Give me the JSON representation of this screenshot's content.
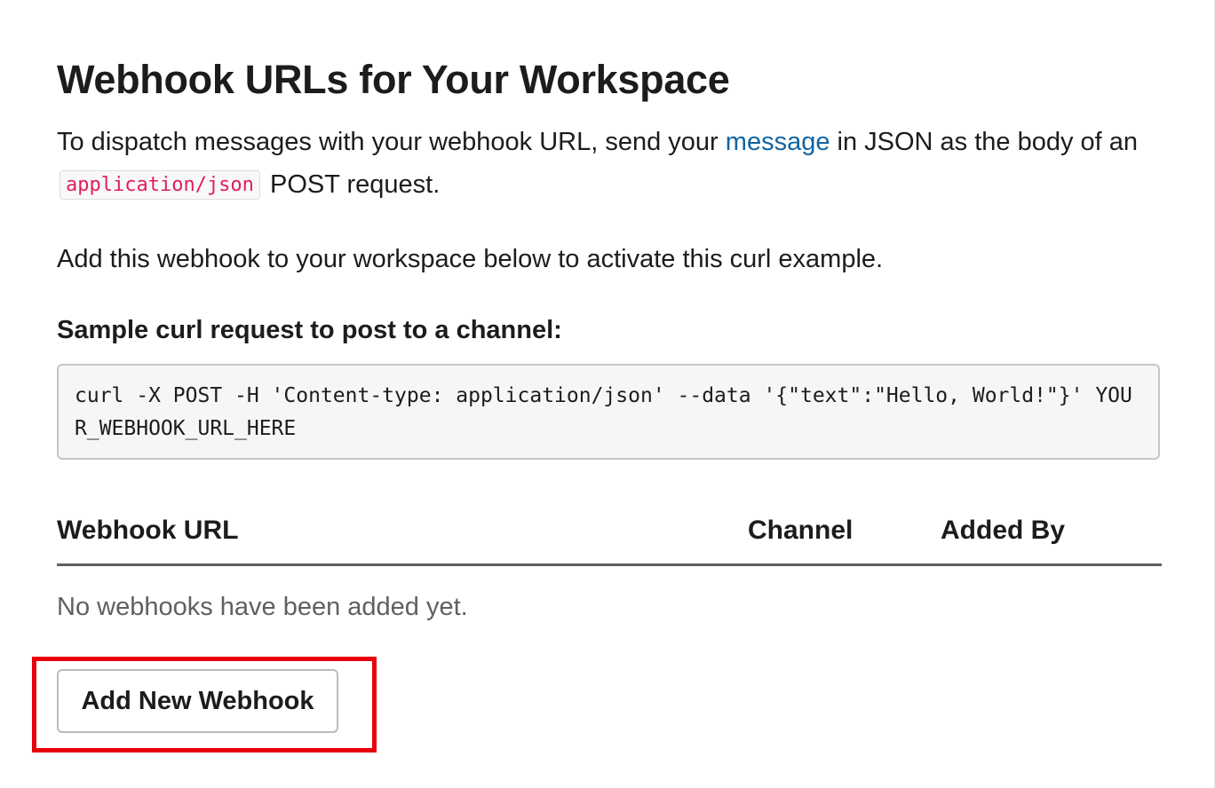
{
  "page": {
    "title": "Webhook URLs for Your Workspace"
  },
  "intro": {
    "before_link": "To dispatch messages with your webhook URL, send your ",
    "link_text": "message",
    "after_link": " in JSON as the body of an ",
    "code": "application/json",
    "after_code": " POST request."
  },
  "activate_note": "Add this webhook to your workspace below to activate this curl example.",
  "sample": {
    "label": "Sample curl request to post to a channel:",
    "code": "curl -X POST -H 'Content-type: application/json' --data '{\"text\":\"Hello, World!\"}' YOUR_WEBHOOK_URL_HERE"
  },
  "table": {
    "columns": [
      "Webhook URL",
      "Channel",
      "Added By"
    ],
    "rows": [],
    "empty_message": "No webhooks have been added yet."
  },
  "actions": {
    "add_webhook_label": "Add New Webhook"
  },
  "colors": {
    "link": "#1264a3",
    "inline_code": "#e01e5a",
    "highlight_border": "#e8000b",
    "text": "#1d1c1d",
    "muted_text": "#616061"
  }
}
